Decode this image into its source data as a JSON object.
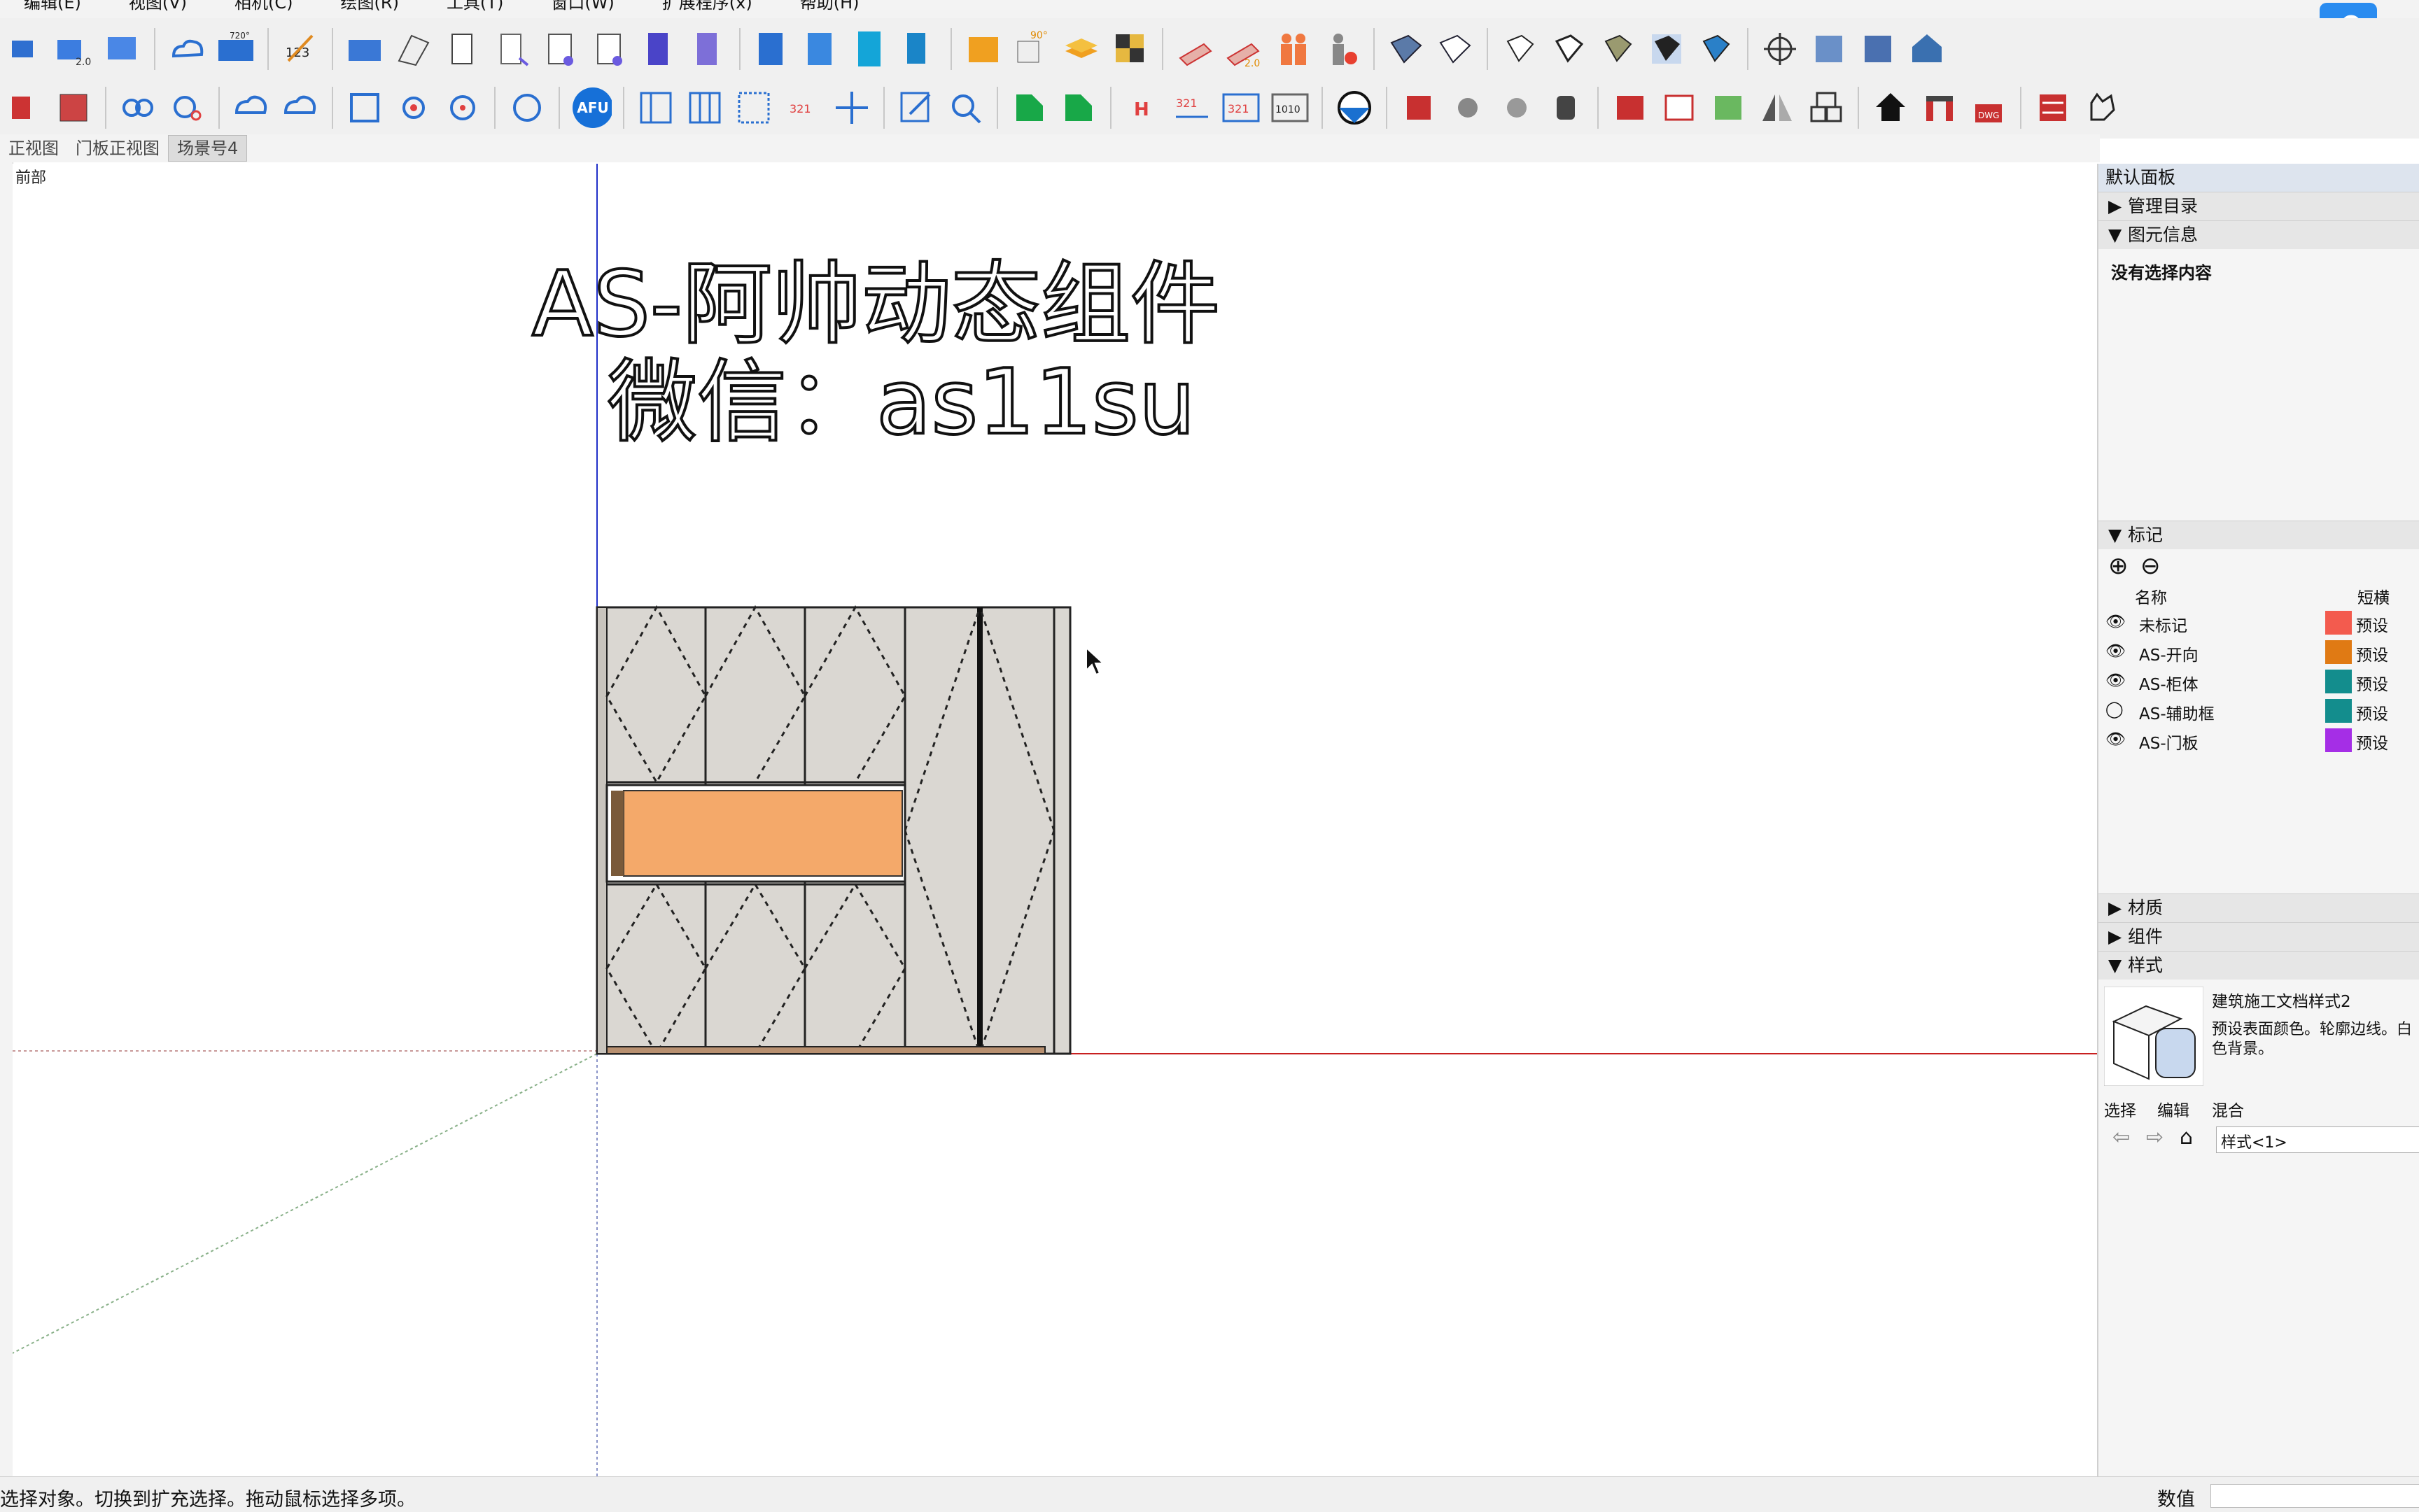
{
  "menu": [
    "编辑(E)",
    "视图(V)",
    "相机(C)",
    "绘图(R)",
    "工具(T)",
    "窗口(W)",
    "扩展程序(x)",
    "帮助(H)"
  ],
  "toolbar_top": {
    "badges": {
      "afu": "AFU",
      "v123": "123",
      "deg90": "90°",
      "deg720": "720°",
      "v20": "2.0",
      "v20b": "2.0"
    }
  },
  "toolbar_bottom": {
    "badges": {
      "v321": "321",
      "v321b": "321",
      "v321c": "321",
      "v1010": "1010",
      "dwg": "DWG",
      "h": "H"
    }
  },
  "scene_tabs": [
    "正视图",
    "门板正视图",
    "场景号4"
  ],
  "active_tab": "场景号4",
  "viewport": {
    "view_label": "前部",
    "title_line1": "AS-阿帅动态组件",
    "title_line2": "微信：as11su",
    "cabinet_colors": {
      "frame": "#dad7d2",
      "drawer": "#f4a96a",
      "line": "#222222"
    }
  },
  "right_panel": {
    "title": "默认面板",
    "manage_dir": "管理目录",
    "entity_info": "图元信息",
    "no_selection": "没有选择内容",
    "tags_section": "标记",
    "tags_header": {
      "name": "名称",
      "dash": "短横"
    },
    "tags": [
      {
        "name": "未标记",
        "color": "#f35b4e",
        "dash": "预设",
        "visible": true
      },
      {
        "name": "AS-开向",
        "color": "#e07a14",
        "dash": "预设",
        "visible": true
      },
      {
        "name": "AS-柜体",
        "color": "#138d8d",
        "dash": "预设",
        "visible": true
      },
      {
        "name": "AS-辅助框",
        "color": "#138d8d",
        "dash": "预设",
        "visible": false
      },
      {
        "name": "AS-门板",
        "color": "#a52ee6",
        "dash": "预设",
        "visible": true
      }
    ],
    "materials": "材质",
    "components": "组件",
    "styles": "样式",
    "style_name": "建筑施工文档样式2",
    "style_desc": "预设表面颜色。轮廓边线。白色背景。",
    "style_tabs": [
      "选择",
      "编辑",
      "混合"
    ],
    "style_select": "样式<1>"
  },
  "status": {
    "message": "选择对象。切换到扩充选择。拖动鼠标选择多项。",
    "value_label": "数值"
  }
}
